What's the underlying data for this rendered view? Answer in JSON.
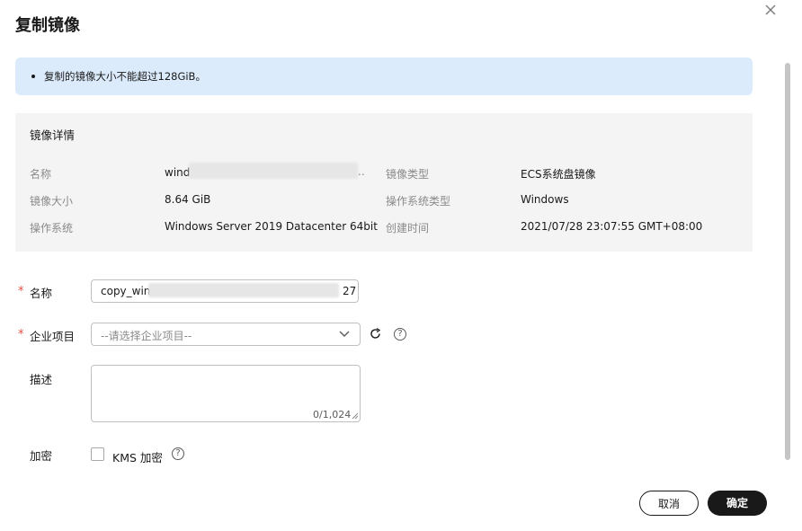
{
  "dialog": {
    "title": "复制镜像",
    "close_label": "×"
  },
  "notice": {
    "text": "复制的镜像大小不能超过128GiB。"
  },
  "details": {
    "title": "镜像详情",
    "rows": [
      {
        "label": "名称",
        "value": "wind",
        "label2": "镜像类型",
        "value2": "ECS系统盘镜像"
      },
      {
        "label": "镜像大小",
        "value": "8.64 GiB",
        "label2": "操作系统类型",
        "value2": "Windows"
      },
      {
        "label": "操作系统",
        "value": "Windows Server 2019 Datacenter 64bit",
        "label2": "创建时间",
        "value2": "2021/07/28 23:07:55 GMT+08:00"
      }
    ],
    "name_ellipsis": ".."
  },
  "form": {
    "required_mark": "*",
    "name": {
      "label": "名称",
      "value_prefix": "copy_win",
      "value_suffix": "27"
    },
    "enterprise": {
      "label": "企业项目",
      "placeholder": "--请选择企业项目--",
      "help": "?"
    },
    "description": {
      "label": "描述",
      "counter": "0/1,024"
    },
    "encryption": {
      "label": "加密",
      "checkbox_label": "KMS 加密",
      "help": "?"
    }
  },
  "footer": {
    "cancel_label": "取消",
    "ok_label": "确定"
  },
  "colors": {
    "notice_bg": "#dcebfb",
    "details_bg": "#f4f4f4",
    "primary_button": "#191919",
    "required": "#e84e40"
  }
}
